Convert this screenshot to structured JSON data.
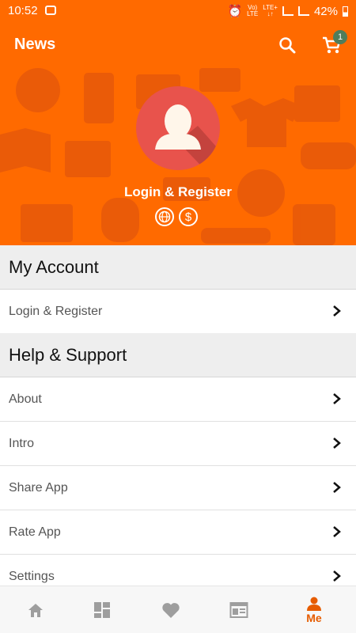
{
  "status_bar": {
    "time": "10:52",
    "network_top": "Vo)",
    "network_bottom": "LTE",
    "network2_top": "LTE+",
    "network2_bottom": "↓↑",
    "battery": "42%"
  },
  "app_bar": {
    "title": "News",
    "cart_badge": "1",
    "icons": [
      "search-icon",
      "cart-icon"
    ]
  },
  "profile": {
    "login_label": "Login & Register",
    "icons": [
      "globe-icon",
      "dollar-icon"
    ]
  },
  "sections": {
    "account": {
      "title": "My Account",
      "items": [
        "Login & Register"
      ]
    },
    "help": {
      "title": "Help & Support",
      "items": [
        "About",
        "Intro",
        "Share App",
        "Rate App",
        "Settings"
      ]
    }
  },
  "bottom_nav": {
    "items": [
      "home-icon",
      "categories-icon",
      "favorites-icon",
      "news-icon",
      "me-icon"
    ],
    "active_label": "Me"
  },
  "colors": {
    "primary": "#ff6a00",
    "avatar_bg": "#e8534c",
    "badge": "#4f7d5b",
    "active_nav": "#e65c00",
    "inactive_nav": "#9e9e9e"
  }
}
